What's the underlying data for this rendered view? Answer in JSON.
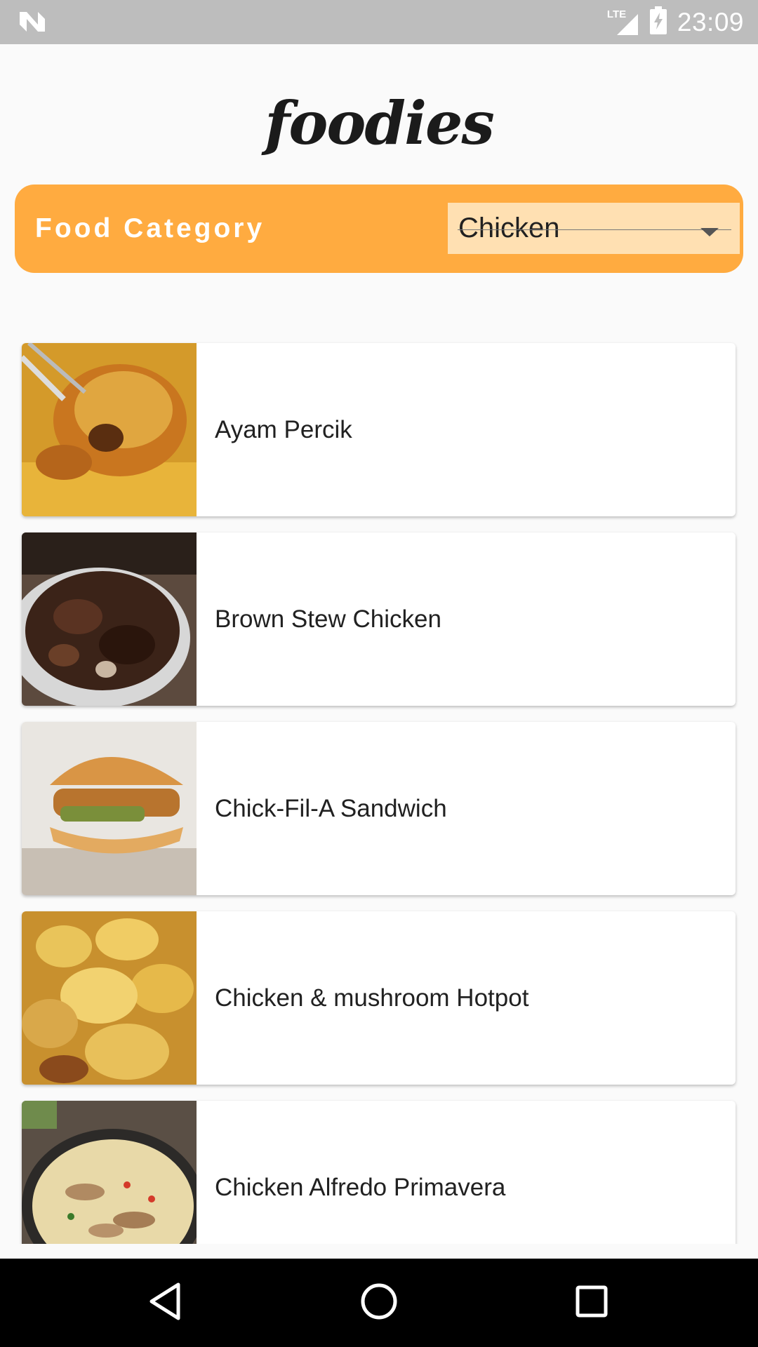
{
  "status_bar": {
    "time": "23:09",
    "network_label": "LTE",
    "icons": [
      "notification-n-icon",
      "lte-signal-icon",
      "battery-charging-icon"
    ]
  },
  "header": {
    "logo_text": "foodies"
  },
  "category": {
    "label": "Food Category",
    "selected": "Chicken"
  },
  "recipes": [
    {
      "name": "Ayam Percik"
    },
    {
      "name": "Brown Stew Chicken"
    },
    {
      "name": "Chick-Fil-A Sandwich"
    },
    {
      "name": "Chicken & mushroom Hotpot"
    },
    {
      "name": "Chicken Alfredo Primavera"
    }
  ],
  "nav_bar": {
    "icons": [
      "back-icon",
      "home-icon",
      "recents-icon"
    ]
  },
  "colors": {
    "accent": "#FFAB40",
    "select_bg": "#FFE0B2",
    "status_bar": "#BDBDBD",
    "background": "#FAFAFA"
  }
}
